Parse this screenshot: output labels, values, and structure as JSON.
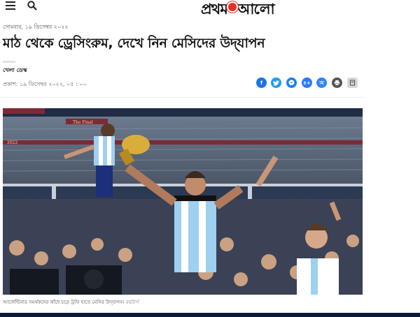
{
  "header": {
    "menu_icon": "hamburger-menu-icon",
    "search_icon": "search-icon",
    "logo_text_left": "প্রথম",
    "logo_text_right": "আলো",
    "logo_color": "#e8302b"
  },
  "article": {
    "date": "সোমবার, ১৯ ডিসেম্বর ২০২২",
    "headline": "মাঠ থেকে ড্রেসিংরুম, দেখে নিন মেসিদের উদ্‌যাপন",
    "author": "খেলা ডেস্ক",
    "published": "প্রকাশ: ১৯ ডিসেম্বর ২০২২, ০৫ : ০০",
    "caption": "আর্জেন্টিনার সমর্থকদের কাঁধে চড়ে ট্রফি হাতে মেসির উদ্‌যাপন।",
    "credit": "রয়টার্স"
  },
  "share": {
    "facebook": "f",
    "twitter": "t",
    "messenger": "m",
    "more_label": "৪+",
    "font_label": "অ",
    "print_icon": "printer-icon",
    "save_icon": "bookmark-icon"
  },
  "photo": {
    "banner_text": "The Final",
    "year_text": "2022"
  }
}
